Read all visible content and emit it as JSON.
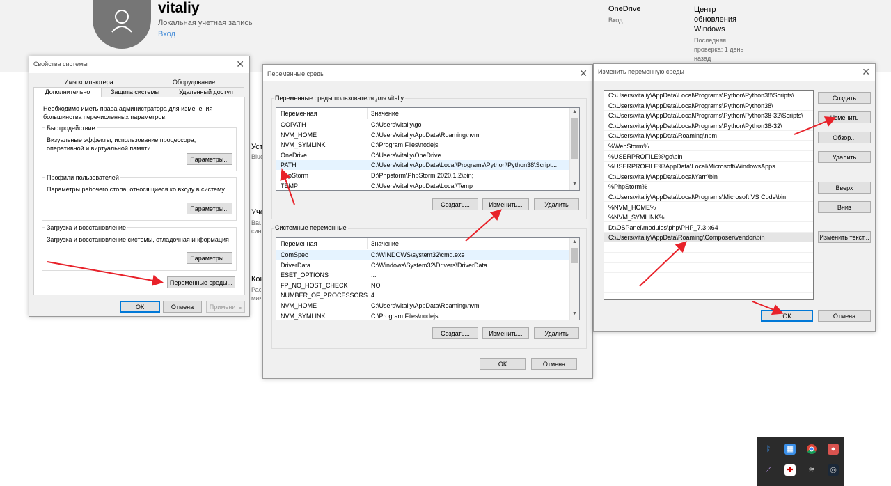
{
  "settings_bg": {
    "username": "vitaliy",
    "account_type": "Локальная учетная запись",
    "sign_in": "Вход",
    "onedrive": {
      "title": "OneDrive",
      "status": "Вход"
    },
    "windows_update": {
      "title": "Центр обновления Windows",
      "status": "Последняя проверка: 1 день назад"
    },
    "partial_items": [
      {
        "title": "Устр",
        "sub": "Blue"
      },
      {
        "title": "Учет",
        "sub": "Ваши синх"
      },
      {
        "title": "Конф",
        "sub": "Расп мик"
      }
    ]
  },
  "sysprops": {
    "title": "Свойства системы",
    "tabs_row1": [
      "Имя компьютера",
      "Оборудование"
    ],
    "tabs_row2": [
      "Дополнительно",
      "Защита системы",
      "Удаленный доступ"
    ],
    "admin_note": "Необходимо иметь права администратора для изменения большинства перечисленных параметров.",
    "performance": {
      "label": "Быстродействие",
      "text": "Визуальные эффекты, использование процессора, оперативной и виртуальной памяти",
      "button": "Параметры..."
    },
    "profiles": {
      "label": "Профили пользователей",
      "text": "Параметры рабочего стола, относящиеся ко входу в систему",
      "button": "Параметры..."
    },
    "startup": {
      "label": "Загрузка и восстановление",
      "text": "Загрузка и восстановление системы, отладочная информация",
      "button": "Параметры..."
    },
    "env_button": "Переменные среды...",
    "ok": "ОК",
    "cancel": "Отмена",
    "apply": "Применить"
  },
  "envvars": {
    "title": "Переменные среды",
    "user_group": "Переменные среды пользователя для vitaliy",
    "col_var": "Переменная",
    "col_val": "Значение",
    "user_vars": [
      {
        "name": "GOPATH",
        "value": "C:\\Users\\vitaliy\\go"
      },
      {
        "name": "NVM_HOME",
        "value": "C:\\Users\\vitaliy\\AppData\\Roaming\\nvm"
      },
      {
        "name": "NVM_SYMLINK",
        "value": "C:\\Program Files\\nodejs"
      },
      {
        "name": "OneDrive",
        "value": "C:\\Users\\vitaliy\\OneDrive"
      },
      {
        "name": "PATH",
        "value": "C:\\Users\\vitaliy\\AppData\\Local\\Programs\\Python\\Python38\\Script..."
      },
      {
        "name": "PhpStorm",
        "value": "D:\\Phpstorm\\PhpStorm 2020.1.2\\bin;"
      },
      {
        "name": "TEMP",
        "value": "C:\\Users\\vitaliy\\AppData\\Local\\Temp"
      }
    ],
    "system_group": "Системные переменные",
    "system_vars": [
      {
        "name": "ComSpec",
        "value": "C:\\WINDOWS\\system32\\cmd.exe"
      },
      {
        "name": "DriverData",
        "value": "C:\\Windows\\System32\\Drivers\\DriverData"
      },
      {
        "name": "ESET_OPTIONS",
        "value": "..."
      },
      {
        "name": "FP_NO_HOST_CHECK",
        "value": "NO"
      },
      {
        "name": "NUMBER_OF_PROCESSORS",
        "value": "4"
      },
      {
        "name": "NVM_HOME",
        "value": "C:\\Users\\vitaliy\\AppData\\Roaming\\nvm"
      },
      {
        "name": "NVM_SYMLINK",
        "value": "C:\\Program Files\\nodejs"
      }
    ],
    "create": "Создать...",
    "edit": "Изменить...",
    "delete": "Удалить",
    "ok": "ОК",
    "cancel": "Отмена"
  },
  "editvar": {
    "title": "Изменить переменную среды",
    "paths": [
      "C:\\Users\\vitaliy\\AppData\\Local\\Programs\\Python\\Python38\\Scripts\\",
      "C:\\Users\\vitaliy\\AppData\\Local\\Programs\\Python\\Python38\\",
      "C:\\Users\\vitaliy\\AppData\\Local\\Programs\\Python\\Python38-32\\Scripts\\",
      "C:\\Users\\vitaliy\\AppData\\Local\\Programs\\Python\\Python38-32\\",
      "C:\\Users\\vitaliy\\AppData\\Roaming\\npm",
      "%WebStorm%",
      "%USERPROFILE%\\go\\bin",
      "%USERPROFILE%\\AppData\\Local\\Microsoft\\WindowsApps",
      "C:\\Users\\vitaliy\\AppData\\Local\\Yarn\\bin",
      "%PhpStorm%",
      "C:\\Users\\vitaliy\\AppData\\Local\\Programs\\Microsoft VS Code\\bin",
      "%NVM_HOME%",
      "%NVM_SYMLINK%",
      "D:\\OSPanel\\modules\\php\\PHP_7.3-x64",
      "C:\\Users\\vitaliy\\AppData\\Roaming\\Composer\\vendor\\bin"
    ],
    "create": "Создать",
    "edit": "Изменить",
    "browse": "Обзор...",
    "delete": "Удалить",
    "up": "Вверх",
    "down": "Вниз",
    "edit_text": "Изменить текст...",
    "ok": "ОК",
    "cancel": "Отмена"
  },
  "tray": {
    "icons": [
      "bluetooth-icon",
      "network-monitor-icon",
      "chrome-icon",
      "app-icon",
      "pen-icon",
      "antivirus-icon",
      "hidden-network-icon",
      "steam-icon"
    ]
  },
  "colors": {
    "annotation": "#e8222a",
    "accent": "#0078d7",
    "tray_bg": "#2b2b2b"
  }
}
